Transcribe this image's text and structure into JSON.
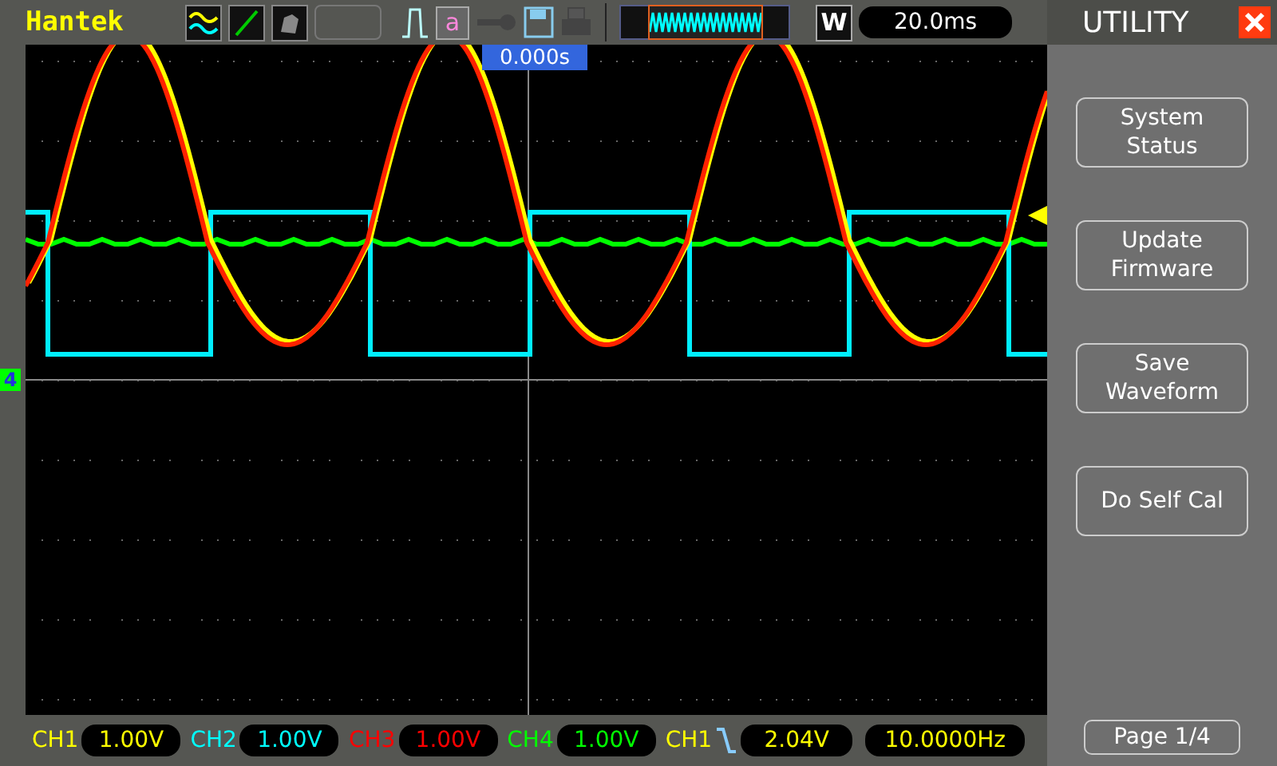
{
  "top_bar": {
    "brand": "Hantek",
    "math_label": "a",
    "mode_label": "W",
    "timebase": "20.0ms"
  },
  "display": {
    "time_offset": "0.000s",
    "channel_marker": "4"
  },
  "channels": [
    {
      "label": "CH1",
      "scale": "1.00V",
      "color": "#ffff00"
    },
    {
      "label": "CH2",
      "scale": "1.00V",
      "color": "#00ffff"
    },
    {
      "label": "CH3",
      "scale": "1.00V",
      "color": "#ff0000"
    },
    {
      "label": "CH4",
      "scale": "1.00V",
      "color": "#00ff00"
    }
  ],
  "trigger": {
    "source": "CH1",
    "level": "2.04V",
    "frequency": "10.0000Hz"
  },
  "menu": {
    "title": "UTILITY",
    "buttons": [
      {
        "label": "System Status"
      },
      {
        "label": "Update Firmware"
      },
      {
        "label": "Save Waveform"
      },
      {
        "label": "Do Self Cal"
      }
    ],
    "page": "Page 1/4"
  }
}
